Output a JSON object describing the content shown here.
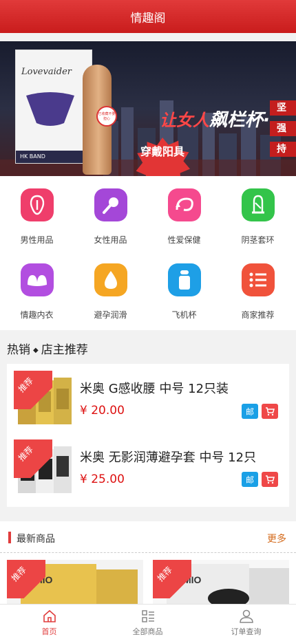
{
  "app": {
    "title": "情趣阁"
  },
  "banner": {
    "box_brand": "Lovevaider",
    "box_bar": "HK BAND",
    "sticker": "已收藏不要担心",
    "burst_text": "穿戴阳具",
    "slogan": "让女人",
    "slogan2": "飙栏杯·",
    "side_chars": [
      "坚",
      "强",
      "持"
    ]
  },
  "categories": [
    {
      "label": "男性用品",
      "icon": "male-products-icon",
      "color": "#ef3e6b"
    },
    {
      "label": "女性用品",
      "icon": "microphone-icon",
      "color": "#a447d8"
    },
    {
      "label": "性爱保健",
      "icon": "tape-measure-icon",
      "color": "#f54a8e"
    },
    {
      "label": "阴茎套环",
      "icon": "condom-icon",
      "color": "#33c44a"
    },
    {
      "label": "情趣内衣",
      "icon": "lingerie-icon",
      "color": "#b24ee0"
    },
    {
      "label": "避孕润滑",
      "icon": "droplet-icon",
      "color": "#f5a623"
    },
    {
      "label": "飞机杯",
      "icon": "masturbator-cup-icon",
      "color": "#1e9fe6"
    },
    {
      "label": "商家推荐",
      "icon": "list-icon",
      "color": "#f0523b"
    }
  ],
  "hot": {
    "title_left": "热销",
    "title_dot": "◆",
    "title_right": "店主推荐",
    "items": [
      {
        "corner": "推荐",
        "name": "米奥 G感收腰 中号 12只装",
        "price": "¥ 20.00",
        "mail": "邮"
      },
      {
        "corner": "推荐",
        "name": "米奥 无影润薄避孕套 中号 12只",
        "price": "¥ 25.00",
        "mail": "邮"
      }
    ]
  },
  "newest": {
    "title": "最新商品",
    "more": "更多",
    "tiles": [
      {
        "corner": "推荐",
        "brand": "MIO"
      },
      {
        "corner": "推荐",
        "brand": "MIO"
      }
    ]
  },
  "tabbar": {
    "tabs": [
      {
        "label": "首页",
        "icon": "home-icon",
        "active": true
      },
      {
        "label": "全部商品",
        "icon": "grid-list-icon",
        "active": false
      },
      {
        "label": "订单查询",
        "icon": "user-icon",
        "active": false
      }
    ]
  },
  "colors": {
    "brand": "#d42828",
    "price": "#dd1111",
    "more": "#d46b1d",
    "mail": "#1aa0e6",
    "cart": "#ef4848"
  }
}
